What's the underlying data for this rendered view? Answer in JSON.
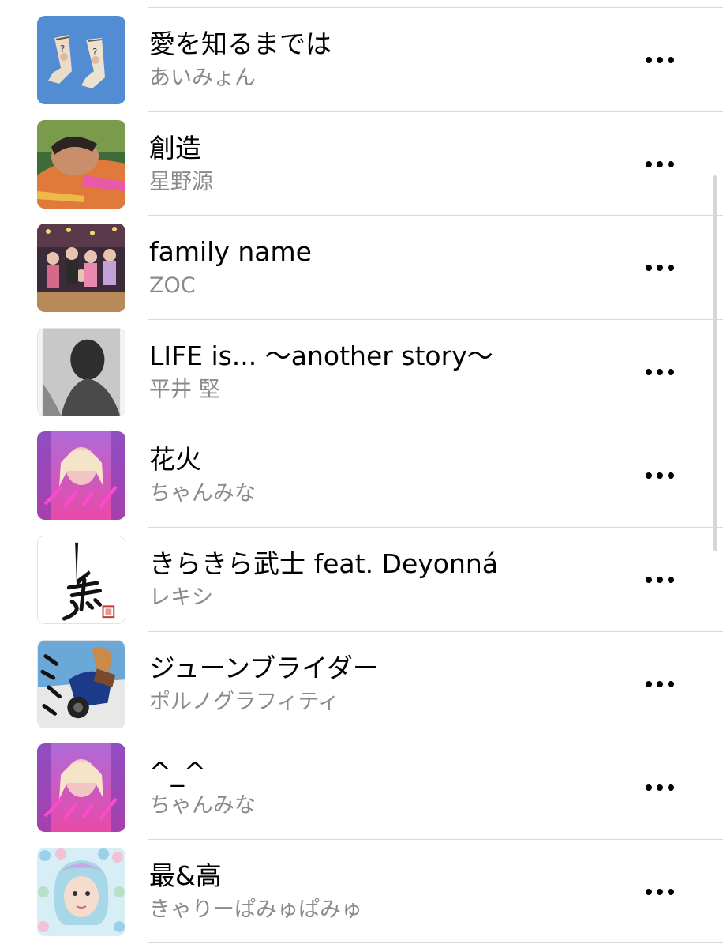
{
  "songs": [
    {
      "title": "愛を知るまでは",
      "artist": "あいみょん",
      "artwork_icon": "socks-artwork"
    },
    {
      "title": "創造",
      "artist": "星野源",
      "artwork_icon": "portrait-artwork"
    },
    {
      "title": "family name",
      "artist": "ZOC",
      "artwork_icon": "group-artwork"
    },
    {
      "title": "LIFE is... ～another story～",
      "artist": "平井 堅",
      "artwork_icon": "bw-portrait-artwork"
    },
    {
      "title": "花火",
      "artist": "ちゃんみな",
      "artwork_icon": "neon-artwork"
    },
    {
      "title": "きらきら武士 feat. Deyonná",
      "artist": "レキシ",
      "artwork_icon": "calligraphy-artwork"
    },
    {
      "title": "ジューンブライダー",
      "artist": "ポルノグラフィティ",
      "artwork_icon": "motorcycle-artwork"
    },
    {
      "title": "^_^",
      "artist": "ちゃんみな",
      "artwork_icon": "neon-artwork"
    },
    {
      "title": "最&高",
      "artist": "きゃりーぱみゅぱみゅ",
      "artwork_icon": "pastel-portrait-artwork"
    }
  ],
  "more_icon": "ellipsis-icon",
  "colors": {
    "title": "#000000",
    "artist": "#8a8a8e",
    "separator": "#d8d8d8"
  }
}
